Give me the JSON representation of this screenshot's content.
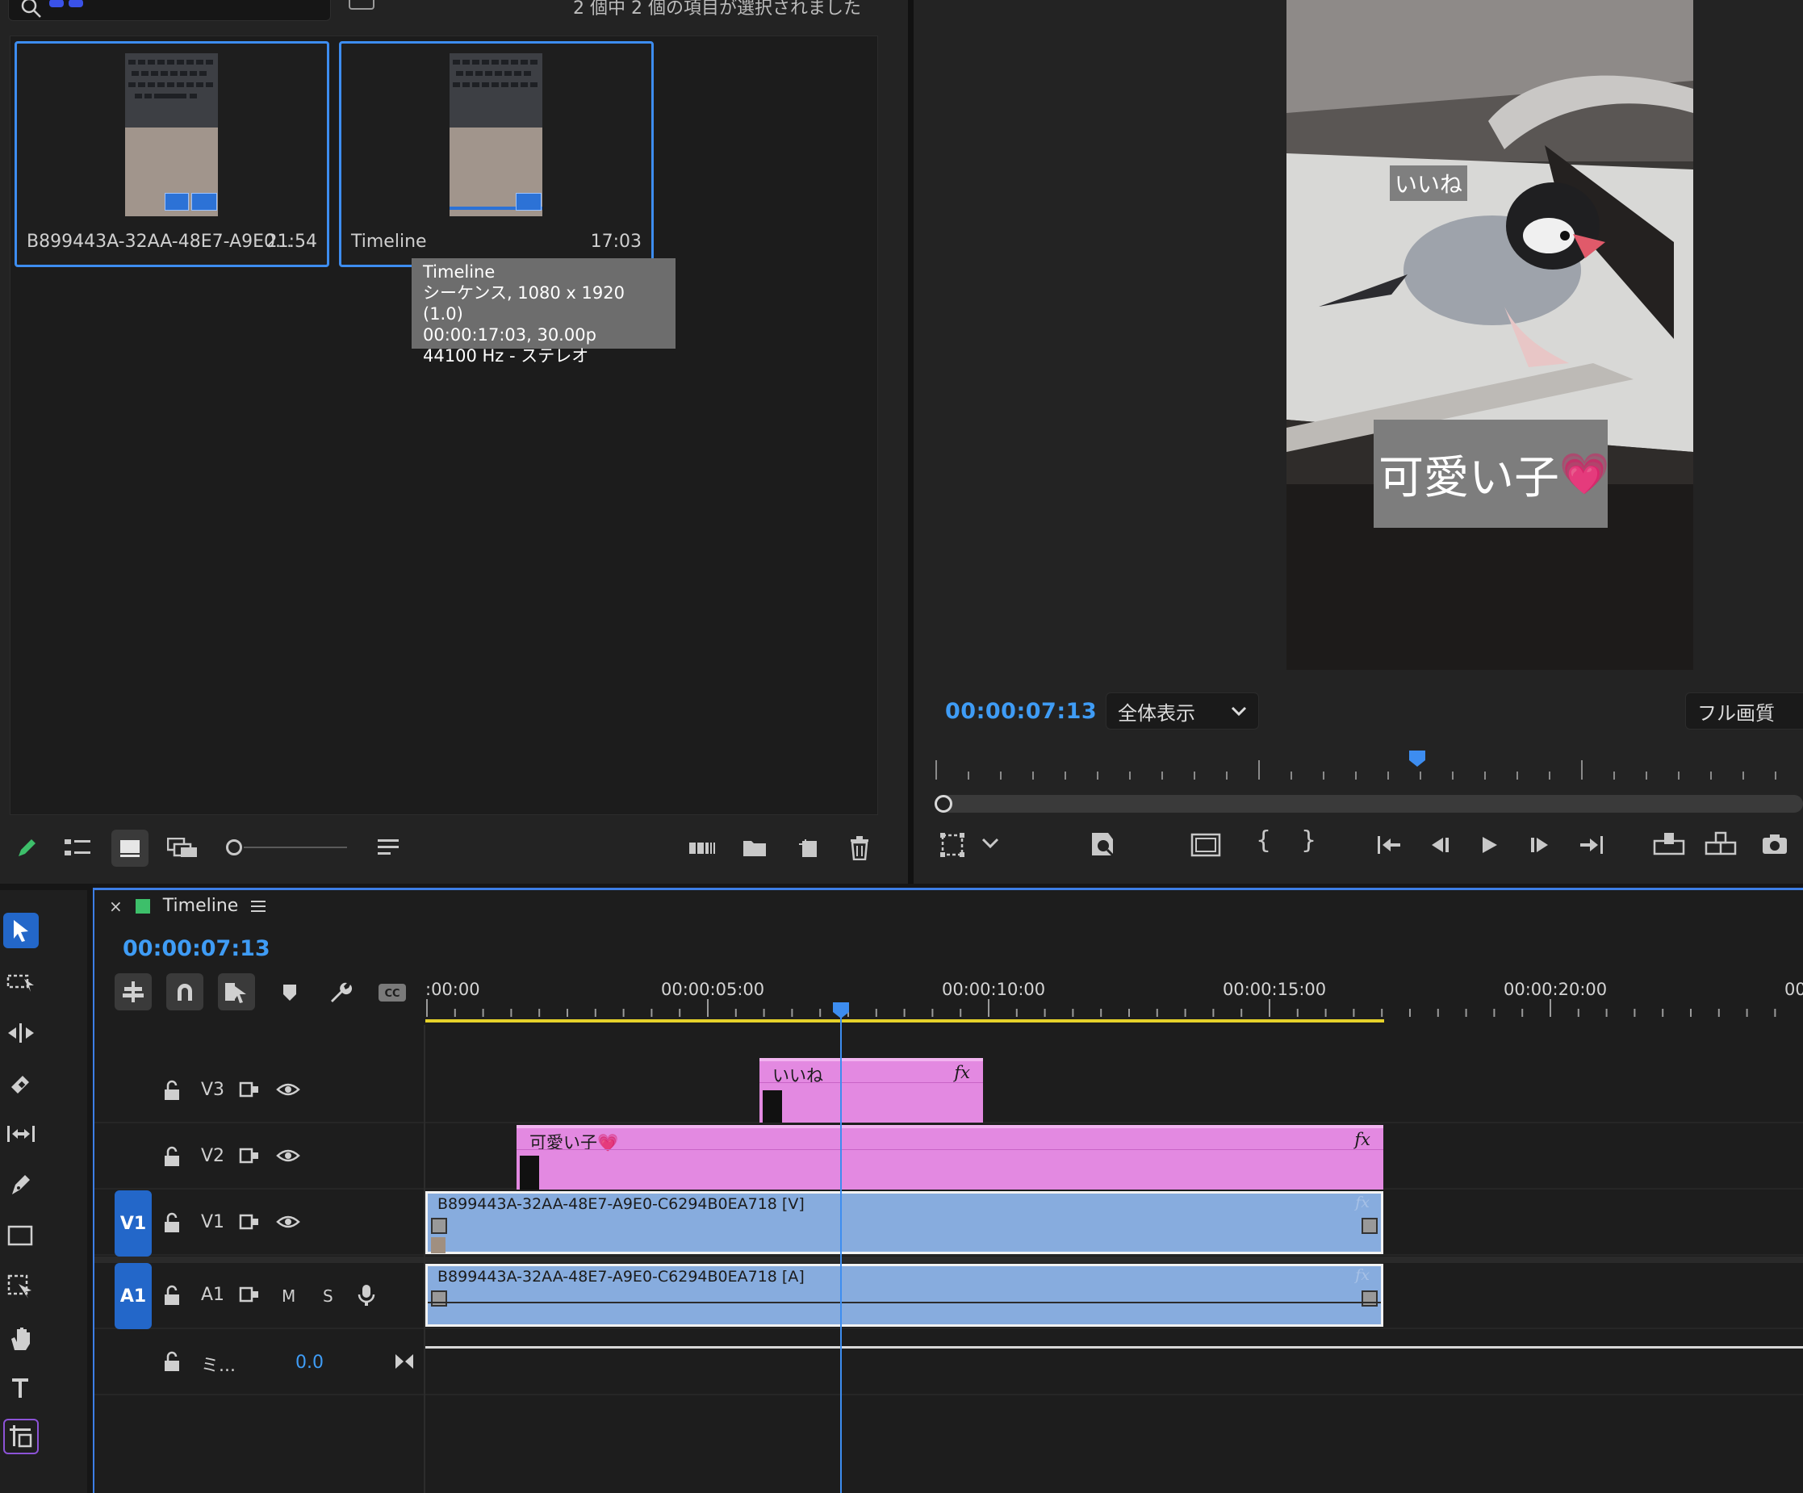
{
  "project": {
    "selection_status": "2 個中 2 個の項目が選択されました",
    "items": [
      {
        "name": "B899443A-32AA-48E7-A9E0...",
        "duration": "21:54"
      },
      {
        "name": "Timeline",
        "duration": "17:03"
      }
    ],
    "tooltip": {
      "title": "Timeline",
      "line1": "シーケンス, 1080 x 1920 (1.0)",
      "line2": "00:00:17:03, 30.00p",
      "line3": "44100 Hz - ステレオ"
    }
  },
  "monitor": {
    "caption_small": "いいね",
    "caption_large": "可愛い子",
    "caption_emoji": "💗",
    "timecode": "00:00:07:13",
    "zoom_select": "全体表示",
    "quality_select": "フル画質"
  },
  "timeline": {
    "tab_title": "Timeline",
    "close_glyph": "×",
    "timecode": "00:00:07:13",
    "ruler_labels": [
      ":00:00",
      "00:00:05:00",
      "00:00:10:00",
      "00:00:15:00",
      "00:00:20:00",
      "00"
    ],
    "tracks": {
      "v3": {
        "name": "V3"
      },
      "v2": {
        "name": "V2"
      },
      "v1": {
        "name": "V1",
        "target": "V1"
      },
      "a1": {
        "name": "A1",
        "target": "A1",
        "mute": "M",
        "solo": "S"
      },
      "mix": {
        "name": "ミ...",
        "volume": "0.0"
      }
    },
    "clips": {
      "v3_graphic": {
        "label": "いいね",
        "fx": "fx"
      },
      "v2_graphic": {
        "label": "可愛い子💗",
        "fx": "fx"
      },
      "v1_video": {
        "label": "B899443A-32AA-48E7-A9E0-C6294B0EA718 [V]",
        "fx": "fx"
      },
      "a1_audio": {
        "label": "B899443A-32AA-48E7-A9E0-C6294B0EA718 [A]",
        "fx": "fx"
      }
    }
  },
  "colors": {
    "accent_blue": "#3d8df0",
    "graphic_clip": "#e389e1",
    "video_clip": "#87acde",
    "work_area": "#e6d22a"
  }
}
